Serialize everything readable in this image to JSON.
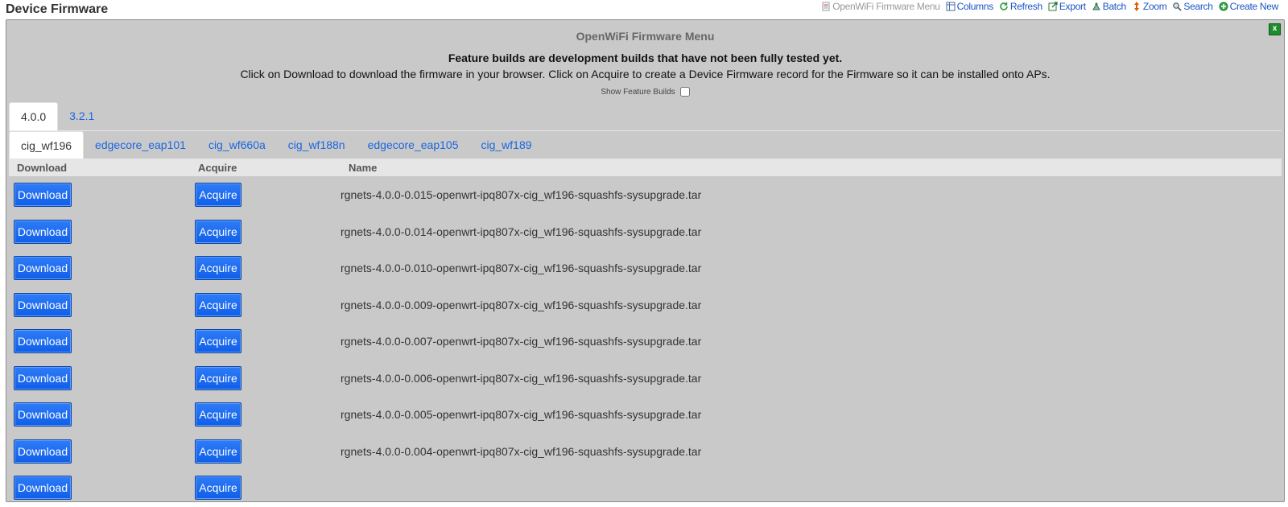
{
  "page": {
    "title": "Device Firmware"
  },
  "toolbar": {
    "items": [
      {
        "label": "OpenWiFi Firmware Menu",
        "icon": "document-icon"
      },
      {
        "label": "Columns",
        "icon": "columns-icon"
      },
      {
        "label": "Refresh",
        "icon": "refresh-icon"
      },
      {
        "label": "Export",
        "icon": "export-icon"
      },
      {
        "label": "Batch",
        "icon": "batch-icon"
      },
      {
        "label": "Zoom",
        "icon": "zoom-icon"
      },
      {
        "label": "Search",
        "icon": "search-icon"
      },
      {
        "label": "Create New",
        "icon": "create-new-icon"
      }
    ]
  },
  "panel": {
    "close_label": "x",
    "title": "OpenWiFi Firmware Menu",
    "notice": "Feature builds are development builds that have not been fully tested yet.",
    "instructions": "Click on Download to download the firmware in your browser. Click on Acquire to create a Device Firmware record for the Firmware so it can be installed onto APs.",
    "feature_toggle_label": "Show Feature Builds"
  },
  "version_tabs": [
    "4.0.0",
    "3.2.1"
  ],
  "model_tabs": [
    "cig_wf196",
    "edgecore_eap101",
    "cig_wf660a",
    "cig_wf188n",
    "edgecore_eap105",
    "cig_wf189"
  ],
  "table": {
    "headers": {
      "download": "Download",
      "acquire": "Acquire",
      "name": "Name"
    },
    "download_label": "Download",
    "acquire_label": "Acquire",
    "rows": [
      "rgnets-4.0.0-0.015-openwrt-ipq807x-cig_wf196-squashfs-sysupgrade.tar",
      "rgnets-4.0.0-0.014-openwrt-ipq807x-cig_wf196-squashfs-sysupgrade.tar",
      "rgnets-4.0.0-0.010-openwrt-ipq807x-cig_wf196-squashfs-sysupgrade.tar",
      "rgnets-4.0.0-0.009-openwrt-ipq807x-cig_wf196-squashfs-sysupgrade.tar",
      "rgnets-4.0.0-0.007-openwrt-ipq807x-cig_wf196-squashfs-sysupgrade.tar",
      "rgnets-4.0.0-0.006-openwrt-ipq807x-cig_wf196-squashfs-sysupgrade.tar",
      "rgnets-4.0.0-0.005-openwrt-ipq807x-cig_wf196-squashfs-sysupgrade.tar",
      "rgnets-4.0.0-0.004-openwrt-ipq807x-cig_wf196-squashfs-sysupgrade.tar",
      ""
    ]
  }
}
